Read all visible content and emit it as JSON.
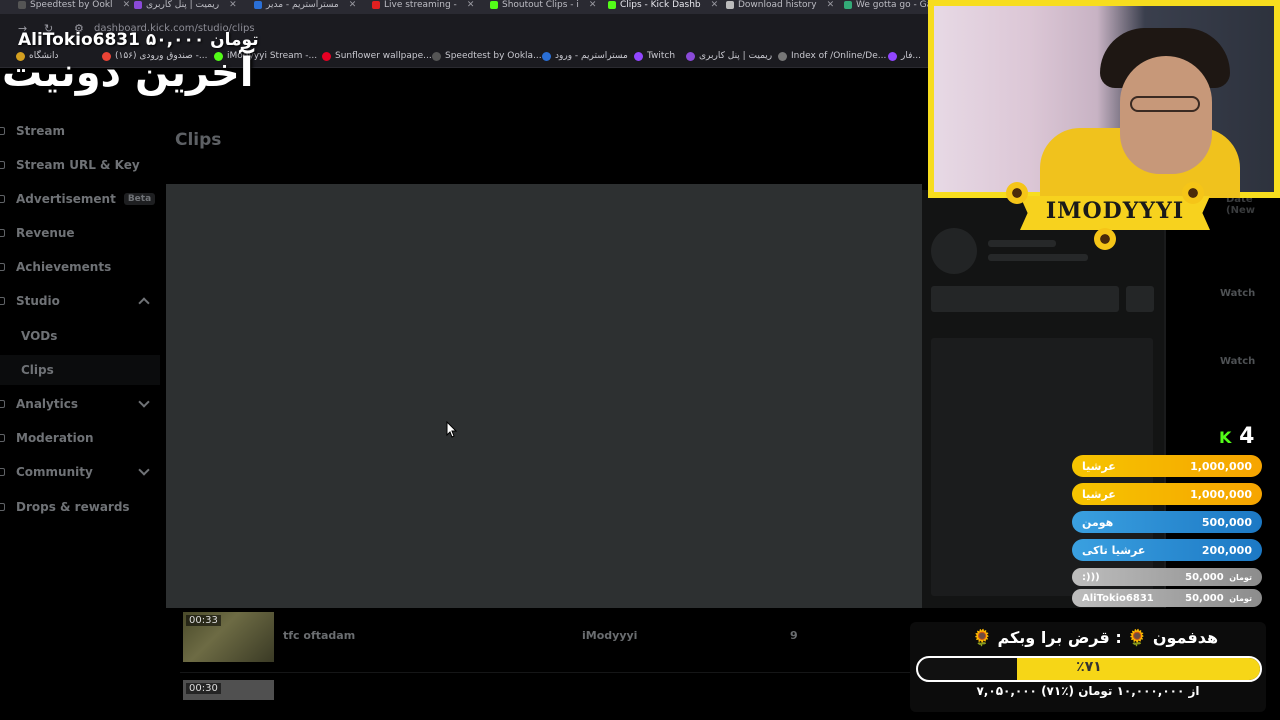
{
  "browser": {
    "tabs": [
      {
        "label": "Speedtest by Ookl",
        "color": "#555"
      },
      {
        "label": "ریمیت | پنل کاربری",
        "color": "#8a4ad8"
      },
      {
        "label": "مستراستریم - مدیر",
        "color": "#2a6fd6"
      },
      {
        "label": "Live streaming -",
        "color": "#e02020"
      },
      {
        "label": "Shoutout Clips - i",
        "color": "#53fc18"
      },
      {
        "label": "Clips - Kick Dashb",
        "color": "#53fc18"
      },
      {
        "label": "Download history",
        "color": "#bbbbbb"
      },
      {
        "label": "We gotta go - Ga",
        "color": "#3a7"
      }
    ],
    "url": "dashboard.kick.com/studio/clips",
    "bookmarks": [
      {
        "label": "دانشگاه",
        "color": "#d4a020"
      },
      {
        "label": "(۱۵۶) صندوق ورودی -...",
        "color": "#ea4335"
      },
      {
        "label": "iModyyyi Stream -...",
        "color": "#53fc18"
      },
      {
        "label": "Sunflower wallpape...",
        "color": "#e60023"
      },
      {
        "label": "Speedtest by Ookla...",
        "color": "#555555"
      },
      {
        "label": "مستراستریم - ورود",
        "color": "#2a6fd6"
      },
      {
        "label": "Twitch",
        "color": "#9146ff"
      },
      {
        "label": "ریمیت | پنل کاربری",
        "color": "#8a4ad8"
      },
      {
        "label": "Index of /Online/De...",
        "color": "#777777"
      },
      {
        "label": "فار...",
        "color": "#9146ff"
      }
    ]
  },
  "sidebar": {
    "items": [
      {
        "label": "Stream"
      },
      {
        "label": "Stream URL & Key"
      },
      {
        "label": "Advertisement",
        "badge": "Beta"
      },
      {
        "label": "Revenue"
      },
      {
        "label": "Achievements"
      },
      {
        "label": "Studio"
      },
      {
        "label": "VODs"
      },
      {
        "label": "Clips"
      },
      {
        "label": "Analytics"
      },
      {
        "label": "Moderation"
      },
      {
        "label": "Community"
      },
      {
        "label": "Drops & rewards"
      }
    ]
  },
  "main": {
    "title": "Clips",
    "column_header": "Date (New",
    "watch_label": "Watch",
    "clips": [
      {
        "duration": "00:33",
        "title": "tfc oftadam",
        "creator": "iModyyyi",
        "views": "9"
      },
      {
        "duration": "00:30"
      }
    ]
  },
  "overlay": {
    "last_donation": "AliTokio6831 ۵۰,۰۰۰ تومان",
    "last_donation_heading": "آخرین دونیت",
    "streamer_name": "IMODYYYI",
    "viewers": "4",
    "leaderboard": [
      {
        "name": "عرشیا",
        "amount": "1,000,000",
        "style": "gold"
      },
      {
        "name": "عرشیا",
        "amount": "1,000,000",
        "style": "gold"
      },
      {
        "name": "هومن",
        "amount": "500,000",
        "style": "blue"
      },
      {
        "name": "عرشیا تاکی",
        "amount": "200,000",
        "style": "blue"
      },
      {
        "name": ":)))",
        "amount": "50,000",
        "unit": "تومان",
        "style": "grey"
      },
      {
        "name": "AliTokio6831",
        "amount": "50,000",
        "unit": "تومان",
        "style": "grey"
      }
    ],
    "goal": {
      "title": "🌻 هدفمون 🌻 : قرض برا وبکم",
      "percent_label": "٪۷۱",
      "progress": 0.71,
      "amount_text": "۷,۰۵۰,۰۰۰ از ۱۰,۰۰۰,۰۰۰ تومان (٪۷۱)"
    }
  },
  "colors": {
    "kick_green": "#53fc18",
    "goal_yellow": "#f6d617",
    "cam_border": "#f7dd1e"
  }
}
